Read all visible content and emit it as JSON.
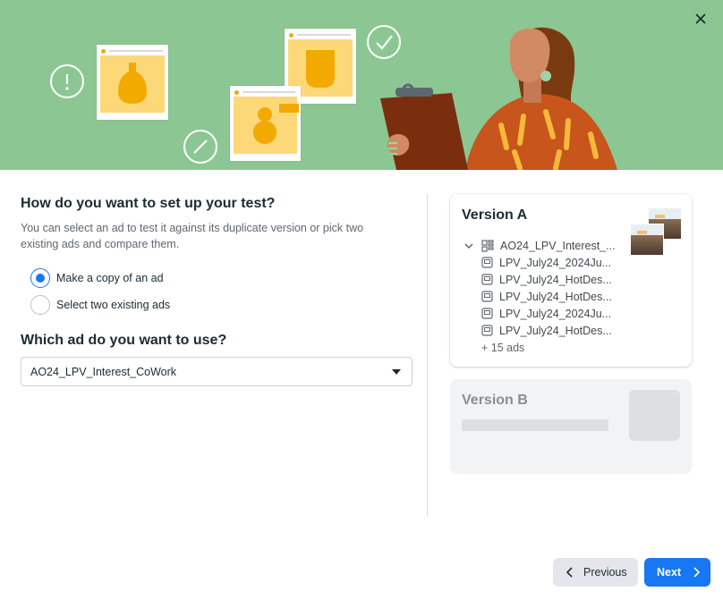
{
  "colors": {
    "hero_bg": "#8cc793",
    "accent": "#1877f2",
    "card_yellow": "#fcd879",
    "icon_orange": "#f3a712"
  },
  "header": {
    "close_icon": "close-icon"
  },
  "setup": {
    "title": "How do you want to set up your test?",
    "description": "You can select an ad to test it against its duplicate version or pick two existing ads and compare them.",
    "options": [
      {
        "label": "Make a copy of an ad",
        "selected": true
      },
      {
        "label": "Select two existing ads",
        "selected": false
      }
    ]
  },
  "ad_select": {
    "title": "Which ad do you want to use?",
    "value": "AO24_LPV_Interest_CoWork"
  },
  "version_a": {
    "title": "Version A",
    "campaign": "AO24_LPV_Interest_...",
    "ads": [
      "LPV_July24_2024Ju...",
      "LPV_July24_HotDes...",
      "LPV_July24_HotDes...",
      "LPV_July24_2024Ju...",
      "LPV_July24_HotDes..."
    ],
    "more": "+ 15 ads"
  },
  "version_b": {
    "title": "Version B"
  },
  "footer": {
    "previous_label": "Previous",
    "next_label": "Next"
  }
}
